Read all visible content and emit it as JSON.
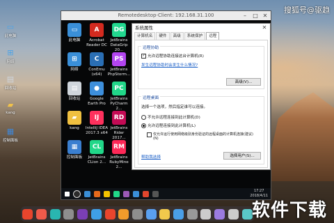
{
  "watermark": "搜狐号@驱趋",
  "brand_watermark": "软件下载",
  "left_desktop": {
    "items": [
      {
        "label": "此电脑",
        "icon": "computer-icon",
        "color": "#4aa3e8",
        "glyph": "▭"
      },
      {
        "label": "网络",
        "icon": "network-icon",
        "color": "#4aa3e8",
        "glyph": "⊞"
      },
      {
        "label": "回收站",
        "icon": "recycle-bin-icon",
        "color": "#cfd6de",
        "glyph": "▤"
      },
      {
        "label": "kang",
        "icon": "user-folder-icon",
        "color": "#f1c24a",
        "glyph": "▰"
      },
      {
        "label": "控制面板",
        "icon": "control-panel-icon",
        "color": "#3f86d6",
        "glyph": "▦"
      }
    ]
  },
  "remote_window": {
    "title": "Remotedesktop-Client: 192.168.31.100",
    "minimize_glyph": "–",
    "maximize_glyph": "□",
    "close_glyph": "✕"
  },
  "remote_desktop": {
    "icons_col1": [
      {
        "label": "此电脑",
        "icon": "computer-icon",
        "color": "#3a8fd8",
        "glyph": "▭"
      },
      {
        "label": "网络",
        "icon": "network-icon",
        "color": "#3a8fd8",
        "glyph": "⊞"
      },
      {
        "label": "回收站",
        "icon": "recycle-bin-icon",
        "color": "#d0d6dc",
        "glyph": "▤"
      },
      {
        "label": "kang",
        "icon": "user-folder-icon",
        "color": "#f0c040",
        "glyph": "▰"
      },
      {
        "label": "控制面板",
        "icon": "control-panel-icon",
        "color": "#3a7fd0",
        "glyph": "▦"
      }
    ],
    "icons_col2": [
      {
        "label": "Acrobat\nReader DC",
        "icon": "acrobat-icon",
        "color": "#d32a1f",
        "glyph": "A"
      },
      {
        "label": "ConEmu\n(x64)",
        "icon": "conemu-icon",
        "color": "#2a6fb5",
        "glyph": "C"
      },
      {
        "label": "Google\nEarth Pro",
        "icon": "google-earth-icon",
        "color": "#3d8fdc",
        "glyph": "●"
      },
      {
        "label": "IntelliJ IDEA\n2017.3 x64",
        "icon": "intellij-icon",
        "color": "#fe315d",
        "glyph": "IJ"
      },
      {
        "label": "JetBrains\nCLion 2...",
        "icon": "clion-icon",
        "color": "#21d789",
        "glyph": "CL"
      }
    ],
    "icons_col3": [
      {
        "label": "JetBrains\nDataGrip 20...",
        "icon": "datagrip-icon",
        "color": "#22d88f",
        "glyph": "DG"
      },
      {
        "label": "JetBrains\nPhpStorm...",
        "icon": "phpstorm-icon",
        "color": "#b345f1",
        "glyph": "PS"
      },
      {
        "label": "JetBrains\nPyCharm 2...",
        "icon": "pycharm-icon",
        "color": "#21d789",
        "glyph": "PC"
      },
      {
        "label": "JetBrains\nRider 2017...",
        "icon": "rider-icon",
        "color": "#c40b55",
        "glyph": "RD"
      },
      {
        "label": "JetBrains\nRubyMine 2...",
        "icon": "rubymine-icon",
        "color": "#fe2857",
        "glyph": "RM"
      }
    ]
  },
  "dialog": {
    "title": "系统属性",
    "close_glyph": "✕",
    "tabs": [
      "计算机名",
      "硬件",
      "高级",
      "系统保护",
      "远程"
    ],
    "active_tab": 4,
    "remote_assist": {
      "group_title": "远程协助",
      "checkbox_label": "允许远程协助连接这台计算机(R)",
      "checkbox_glyph": "✓",
      "link": "发生远程协助时会发生什么情况?",
      "advanced_button": "高级(V)..."
    },
    "remote_desktop": {
      "group_title": "远程桌面",
      "prompt": "选择一个选项，然后指定谁可以连接。",
      "option_deny": "不允许远程连接到此计算机(D)",
      "option_allow": "允许远程连接到此计算机(L)",
      "nla_label": "仅允许运行使用网络级别身份验证的远程桌面的计算机连接(建议)",
      "nla_label_line2": "(N)",
      "help_link": "帮助我选择",
      "users_button": "选择用户(S)..."
    }
  },
  "remote_taskbar": {
    "time": "17:27",
    "date": "2018/4/11",
    "icon_colors": [
      "#ffffff",
      "#2b2b2b",
      "#3a8fd8",
      "#e56a1c",
      "#f2c200",
      "#21d789",
      "#9b59b6",
      "#3a8fd8",
      "#e2462d",
      "#555555"
    ]
  },
  "dock": {
    "icon_colors": [
      "#e8452d",
      "#ef5a4a",
      "#29b6b0",
      "#8e8e8e",
      "#7b3fb5",
      "#3fa0e6",
      "#e8452d",
      "#f29b2b",
      "#8e8e8e",
      "#5aa0f0",
      "#f2c94c",
      "#4a9fe8",
      "#999999",
      "#cccccc",
      "#9b7be0",
      "#cccccc",
      "#5ac8c8"
    ]
  }
}
